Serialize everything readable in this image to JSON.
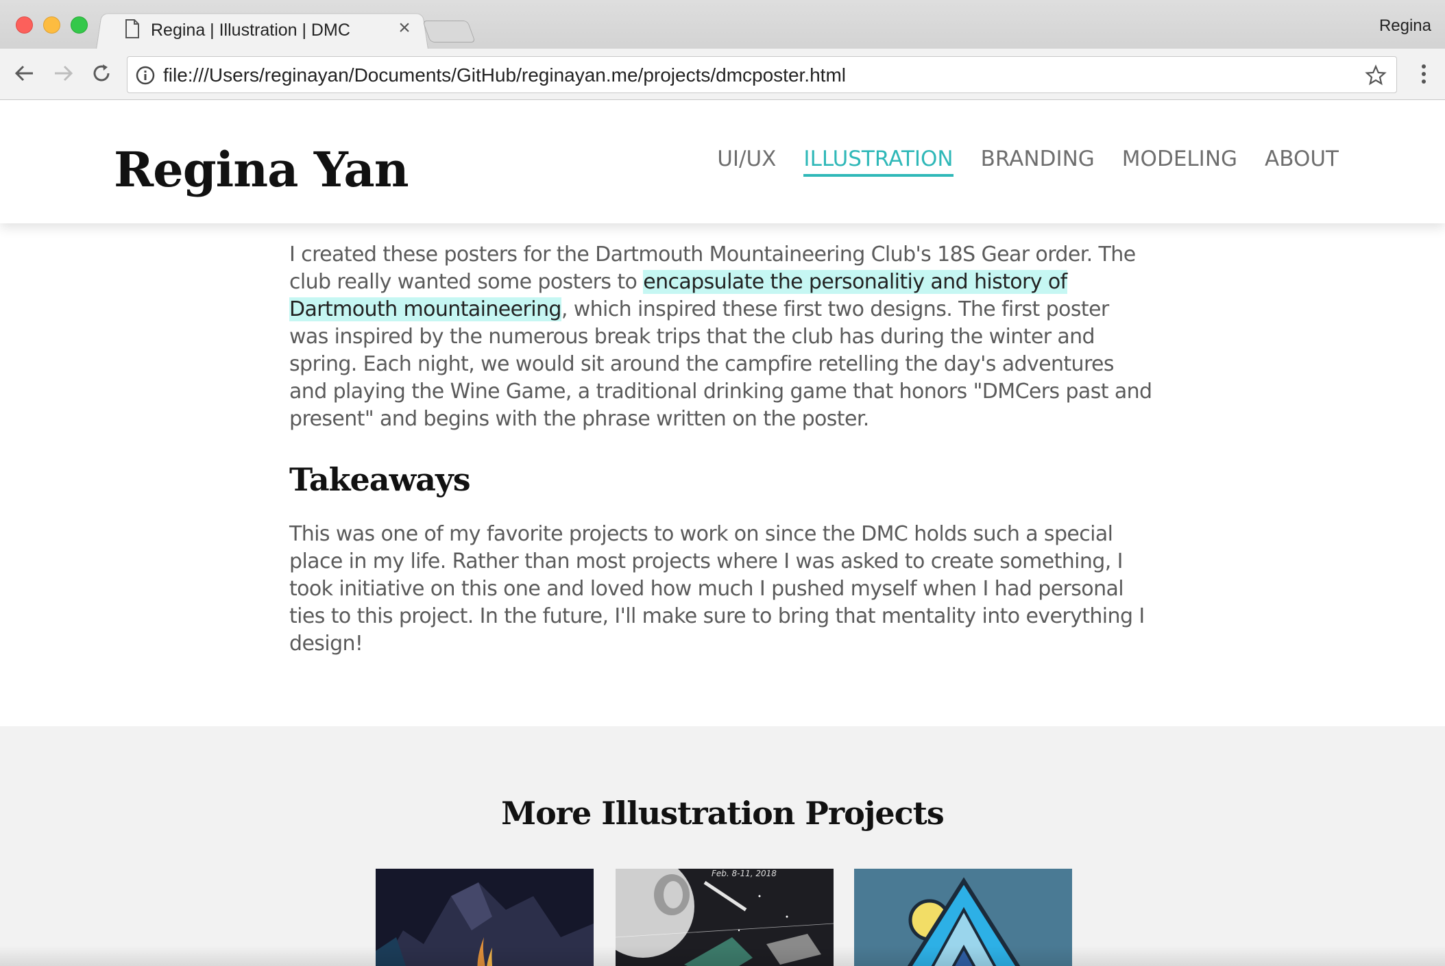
{
  "browser": {
    "tab_title": "Regina | Illustration | DMC",
    "tab_close": "×",
    "profile_name": "Regina",
    "url": "file:///Users/reginayan/Documents/GitHub/reginayan.me/projects/dmcposter.html"
  },
  "site": {
    "logo": "Regina Yan",
    "nav": [
      {
        "label": "UI/UX",
        "active": false
      },
      {
        "label": "ILLUSTRATION",
        "active": true
      },
      {
        "label": "BRANDING",
        "active": false
      },
      {
        "label": "MODELING",
        "active": false
      },
      {
        "label": "ABOUT",
        "active": false
      }
    ],
    "accent_color": "#2fb8b8",
    "highlight_color": "#c6f7f3"
  },
  "article": {
    "intro_before": "I created these posters for the Dartmouth Mountaineering Club's 18S Gear order. The club really wanted some posters to ",
    "intro_highlight": "encapsulate the personalitiy and history of Dartmouth mountaineering",
    "intro_after": ", which inspired these first two designs. The first poster was inspired by the numerous break trips that the club has during the winter and spring. Each night, we would sit around the campfire retelling the day's adventures and playing the Wine Game, a traditional drinking game that honors \"DMCers past and present\" and begins with the phrase written on the poster.",
    "takeaways_heading": "Takeaways",
    "takeaways_text": "This was one of my favorite projects to work on since the DMC holds such a special place in my life. Rather than most projects where I was asked to create something, I took initiative on this one and loved how much I pushed myself when I had personal ties to this project. In the future, I'll make sure to bring that mentality into everything I design!"
  },
  "more": {
    "title": "More Illustration Projects",
    "thumbnails": [
      {
        "name": "campfire-mountain-poster"
      },
      {
        "name": "space-poster",
        "date_text": "Feb. 8-11, 2018"
      },
      {
        "name": "mountain-logo"
      }
    ]
  }
}
